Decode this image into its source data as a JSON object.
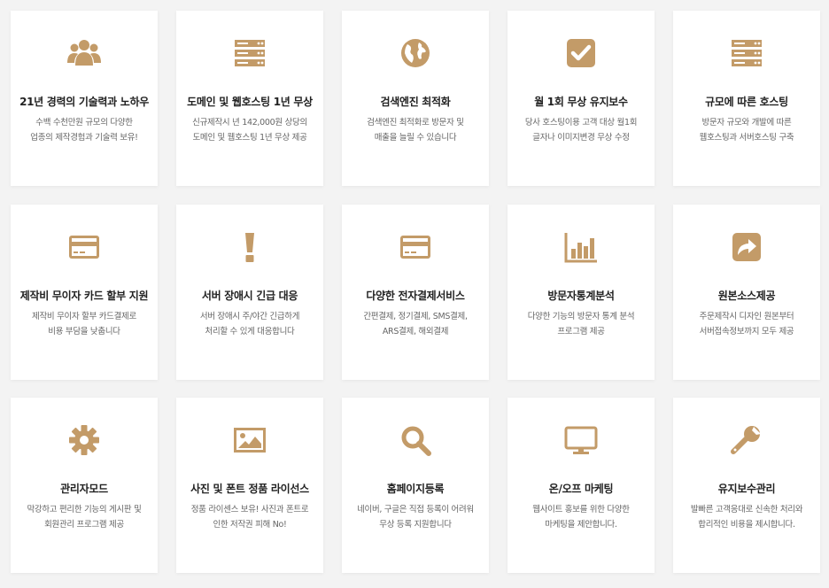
{
  "accent_color": "#c39b68",
  "cards": [
    {
      "icon": "users-icon",
      "title": "21년 경력의 기술력과 노하우",
      "desc": [
        "수백 수천만원 규모의 다양한",
        "업종의 제작경험과 기술력 보유!"
      ]
    },
    {
      "icon": "server-icon",
      "title": "도메인 및 웹호스팅 1년 무상",
      "desc": [
        "신규제작시 년 142,000원 상당의",
        "도메인 및 웹호스팅 1년 무상 제공"
      ]
    },
    {
      "icon": "globe-icon",
      "title": "검색엔진 최적화",
      "desc": [
        "검색엔진 최적화로 방문자 및",
        "매출을 늘릴 수 있습니다"
      ]
    },
    {
      "icon": "check-square-icon",
      "title": "월 1회 무상 유지보수",
      "desc": [
        "당사 호스팅이용 고객 대상 월1회",
        "글자나 이미지변경 무상 수정"
      ]
    },
    {
      "icon": "server-icon",
      "title": "규모에 따른 호스팅",
      "desc": [
        "방문자 규모와 개발에 따른",
        "웹호스팅과 서버호스팅 구축"
      ]
    },
    {
      "icon": "credit-card-icon",
      "title": "제작비 무이자 카드 할부 지원",
      "desc": [
        "제작비 무이자 할부 카드결제로",
        "비용 부담을 낮춥니다"
      ]
    },
    {
      "icon": "exclamation-icon",
      "title": "서버 장애시 긴급 대응",
      "desc": [
        "서버 장애시 주/야간 긴급하게",
        "처리할 수 있게 대응합니다"
      ]
    },
    {
      "icon": "credit-card-icon",
      "title": "다양한 전자결제서비스",
      "desc": [
        "간편결제, 정기결제, SMS결제,",
        "ARS결제, 해외결제"
      ]
    },
    {
      "icon": "bar-chart-icon",
      "title": "방문자통계분석",
      "desc": [
        "다양한 기능의 방문자 통계 분석",
        "프로그램 제공"
      ]
    },
    {
      "icon": "share-square-icon",
      "title": "원본소스제공",
      "desc": [
        "주문제작시 디자인 원본부터",
        "서버접속정보까지 모두 제공"
      ]
    },
    {
      "icon": "gear-icon",
      "title": "관리자모드",
      "desc": [
        "막강하고 편리한 기능의 게시판 및",
        "회원관리 프로그램 제공"
      ]
    },
    {
      "icon": "image-icon",
      "title": "사진 및 폰트 정품 라이선스",
      "desc": [
        "정품 라이센스 보유! 사진과 폰트로",
        "인한 저작권 피해 No!"
      ]
    },
    {
      "icon": "search-icon",
      "title": "홈페이지등록",
      "desc": [
        "네이버, 구글은 직접 등록이 어려워",
        "무상 등록 지원합니다"
      ]
    },
    {
      "icon": "desktop-icon",
      "title": "온/오프 마케팅",
      "desc": [
        "웹사이트 홍보를 위한 다양한",
        "마케팅을 제안합니다."
      ]
    },
    {
      "icon": "wrench-icon",
      "title": "유지보수관리",
      "desc": [
        "발빠른 고객응대로 신속한 처리와",
        "합리적인 비용을 제시합니다."
      ]
    }
  ]
}
